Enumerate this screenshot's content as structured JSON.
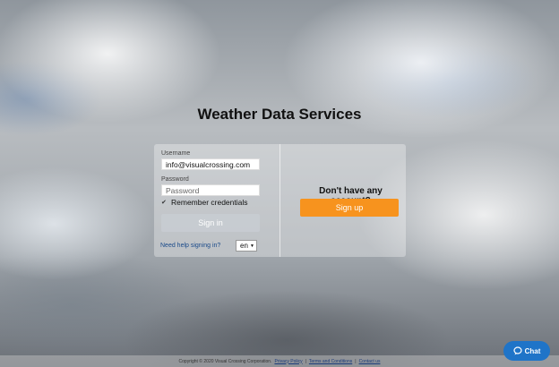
{
  "page": {
    "title": "Weather Data Services"
  },
  "login": {
    "username_label": "Username",
    "username_value": "info@visualcrossing.com",
    "password_label": "Password",
    "password_placeholder": "Password",
    "remember_label": "Remember credentials",
    "signin_label": "Sign in",
    "help_link": "Need help signing in?",
    "language": "en"
  },
  "signup": {
    "question": "Don't have any account?",
    "button_label": "Sign up"
  },
  "footer": {
    "copyright": "Copyright © 2020 Visual Crossing Corporation.",
    "privacy": "Privacy Policy",
    "terms": "Terms and Conditions",
    "contact": "Contact us"
  },
  "chat": {
    "label": "Chat"
  },
  "colors": {
    "accent": "#f7931e",
    "chat": "#1f74c8"
  }
}
